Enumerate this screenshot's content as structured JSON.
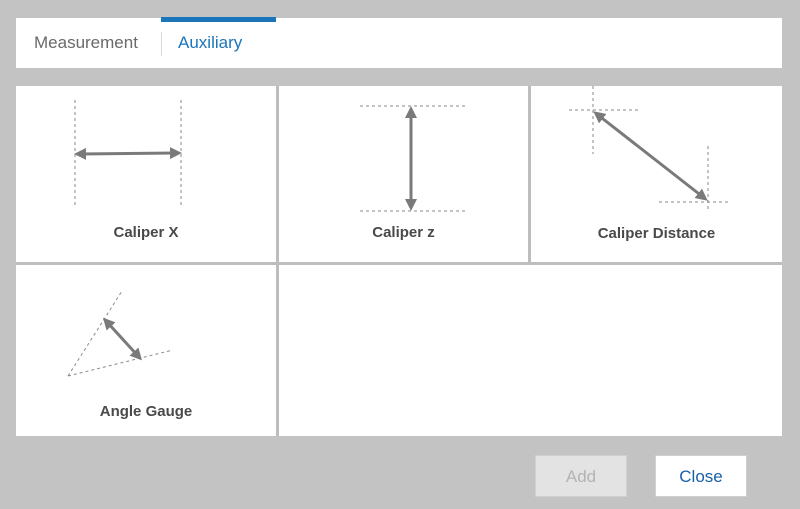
{
  "tabs": {
    "measurement_label": "Measurement",
    "auxiliary_label": "Auxiliary",
    "active": "Auxiliary"
  },
  "tools": [
    {
      "label": "Caliper X",
      "icon": "caliper-x-icon"
    },
    {
      "label": "Caliper z",
      "icon": "caliper-z-icon"
    },
    {
      "label": "Caliper Distance",
      "icon": "caliper-distance-icon"
    },
    {
      "label": "Angle Gauge",
      "icon": "angle-gauge-icon"
    }
  ],
  "buttons": {
    "add_label": "Add",
    "add_enabled": false,
    "close_label": "Close"
  },
  "colors": {
    "accent": "#1a75bb",
    "background": "#c3c3c3",
    "icon_stroke": "#7a7a7a"
  }
}
